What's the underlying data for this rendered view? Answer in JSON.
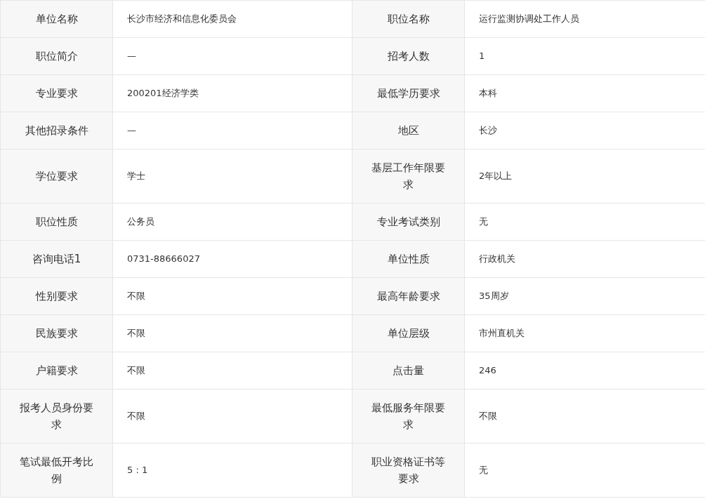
{
  "fields": [
    {
      "label": "单位名称",
      "value": "长沙市经济和信息化委员会"
    },
    {
      "label": "职位名称",
      "value": "运行监测协调处工作人员"
    },
    {
      "label": "职位简介",
      "value": "—"
    },
    {
      "label": "招考人数",
      "value": "1"
    },
    {
      "label": "专业要求",
      "value": "200201经济学类"
    },
    {
      "label": "最低学历要求",
      "value": "本科"
    },
    {
      "label": "其他招录条件",
      "value": "—"
    },
    {
      "label": "地区",
      "value": "长沙"
    },
    {
      "label": "学位要求",
      "value": "学士"
    },
    {
      "label": "基层工作年限要求",
      "value": "2年以上"
    },
    {
      "label": "职位性质",
      "value": "公务员"
    },
    {
      "label": "专业考试类别",
      "value": "无"
    },
    {
      "label": "咨询电话1",
      "value": "0731-88666027"
    },
    {
      "label": "单位性质",
      "value": "行政机关"
    },
    {
      "label": "性别要求",
      "value": "不限"
    },
    {
      "label": "最高年龄要求",
      "value": "35周岁"
    },
    {
      "label": "民族要求",
      "value": "不限"
    },
    {
      "label": "单位层级",
      "value": "市州直机关"
    },
    {
      "label": "户籍要求",
      "value": "不限"
    },
    {
      "label": "点击量",
      "value": "246"
    },
    {
      "label": "报考人员身份要求",
      "value": "不限"
    },
    {
      "label": "最低服务年限要求",
      "value": "不限"
    },
    {
      "label": "笔试最低开考比例",
      "value": "5 : 1"
    },
    {
      "label": "职业资格证书等要求",
      "value": "无"
    }
  ]
}
